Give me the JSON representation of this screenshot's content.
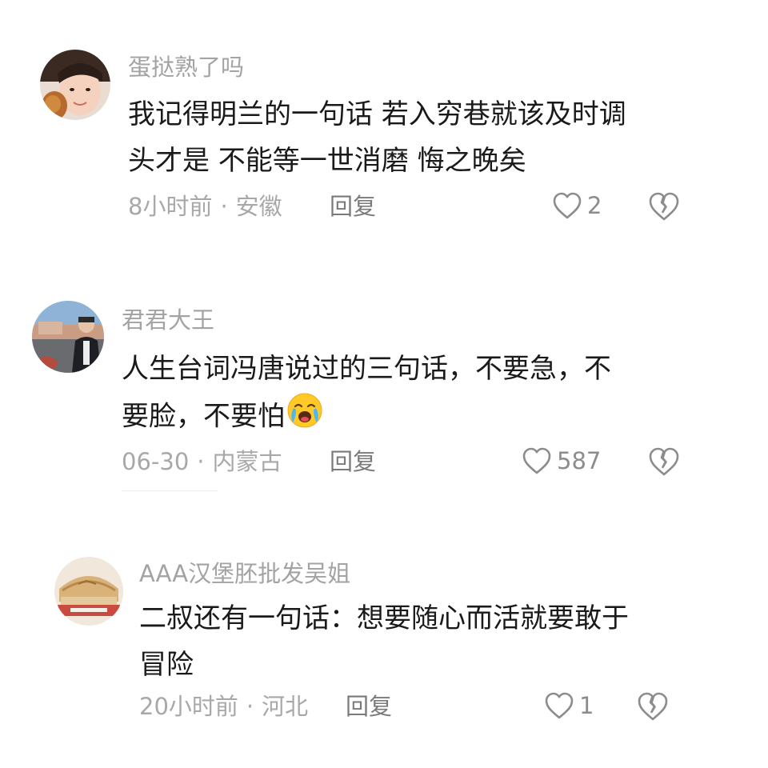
{
  "comments": [
    {
      "username": "蛋挞熟了吗",
      "text_lines": [
        "我记得明兰的一句话 若入穷巷就该及时调",
        "头才是 不能等一世消磨 悔之晚矣"
      ],
      "time": "8小时前",
      "separator": "·",
      "location": "安徽",
      "reply_label": "回复",
      "like_count": "2",
      "avatar_icon": "girl-photo-avatar"
    },
    {
      "username": "君君大王",
      "text_lines": [
        "人生台词冯唐说过的三句话，不要急，不",
        "要脸，不要怕"
      ],
      "emoji": "crying-laughing-emoji",
      "time": "06-30",
      "separator": "·",
      "location": "内蒙古",
      "reply_label": "回复",
      "like_count": "587",
      "avatar_icon": "man-photo-avatar"
    },
    {
      "username": "AAA汉堡胚批发吴姐",
      "text_lines": [
        "二叔还有一句话：想要随心而活就要敢于",
        "冒险"
      ],
      "time": "20小时前",
      "separator": "·",
      "location": "河北",
      "reply_label": "回复",
      "like_count": "1",
      "avatar_icon": "burger-photo-avatar"
    }
  ],
  "icons": {
    "like": "heart-outline-icon",
    "dislike": "broken-heart-icon"
  },
  "colors": {
    "username": "#a3a3a3",
    "text": "#1a1a1a",
    "meta": "#a8a8a8",
    "icon": "#8c8c8c"
  }
}
